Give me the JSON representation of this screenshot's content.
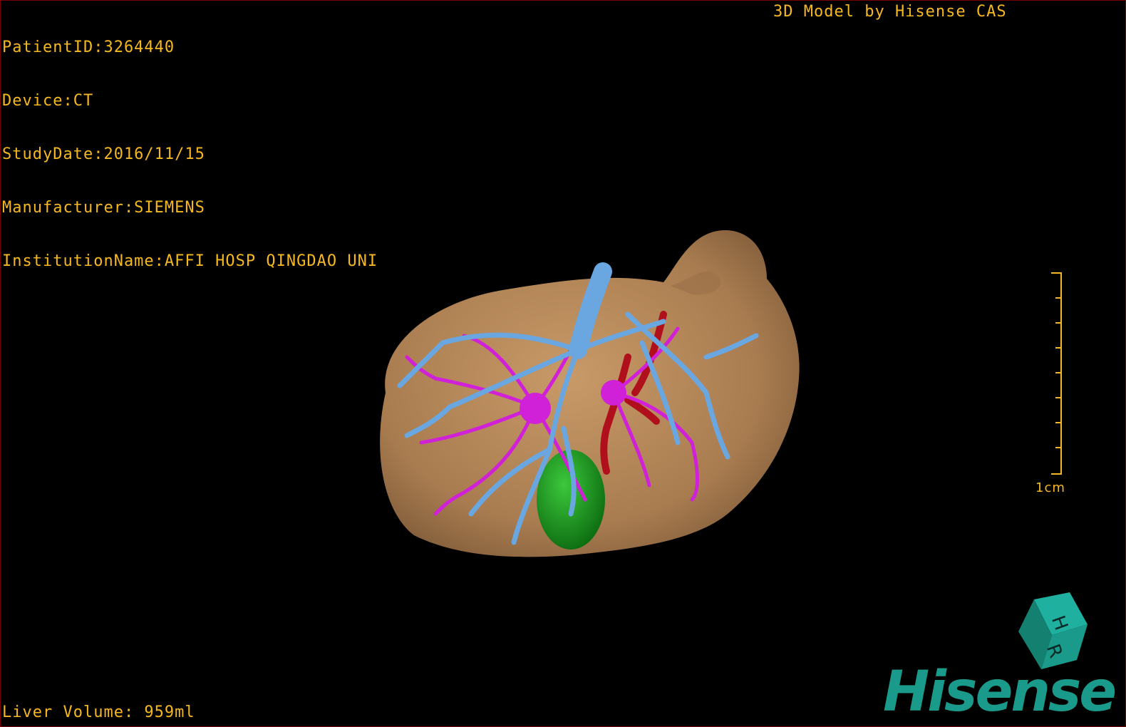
{
  "dicom_info": {
    "patient_id": "PatientID:3264440",
    "device": "Device:CT",
    "study_date": "StudyDate:2016/11/15",
    "manufacturer": "Manufacturer:SIEMENS",
    "institution": "InstitutionName:AFFI HOSP QINGDAO UNI"
  },
  "title": "3D Model by Hisense CAS",
  "liver_volume": "Liver Volume: 959ml",
  "scale_label": "1cm",
  "orientation_cube": {
    "labels": [
      "H",
      "R"
    ],
    "color": "#1a9a8a"
  },
  "logo": "Hisense",
  "colors": {
    "text": "#f5b820",
    "liver": "#b08458",
    "portal_vein": "#6aa6e0",
    "hepatic_vein": "#d020d8",
    "artery": "#b0101c",
    "gallbladder": "#1a9a20",
    "logo": "#1a9a8a"
  }
}
